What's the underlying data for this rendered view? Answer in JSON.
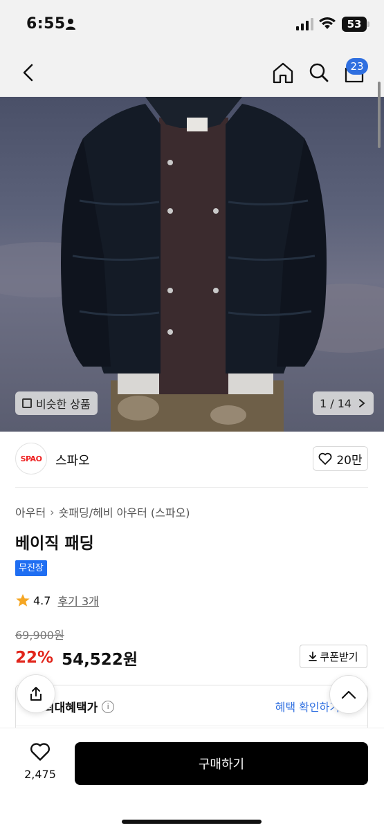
{
  "status_bar": {
    "time": "6:55",
    "battery": "53"
  },
  "nav": {
    "cart_badge": "23"
  },
  "gallery": {
    "similar_label": "비슷한 상품",
    "pager": "1 / 14"
  },
  "brand": {
    "logo_text": "SPAO",
    "name": "스파오",
    "likes": "20만"
  },
  "product": {
    "breadcrumb": [
      "아우터",
      "숏패딩/헤비 아우터 (스파오)"
    ],
    "title": "베이직 패딩",
    "tag": "무진장",
    "rating": "4.7",
    "reviews": "후기 3개",
    "original_price": "69,900원",
    "discount": "22%",
    "price": "54,522원",
    "coupon_label": "쿠폰받기"
  },
  "benefit": {
    "label": "최대혜택가",
    "confirm": "혜택 확인하기"
  },
  "bottom": {
    "wish_count": "2,475",
    "buy_label": "구매하기"
  },
  "colors": {
    "accent_blue": "#2f6fe0",
    "tag_blue": "#1f6ef2",
    "discount_red": "#e1251b",
    "star": "#f5a623"
  }
}
